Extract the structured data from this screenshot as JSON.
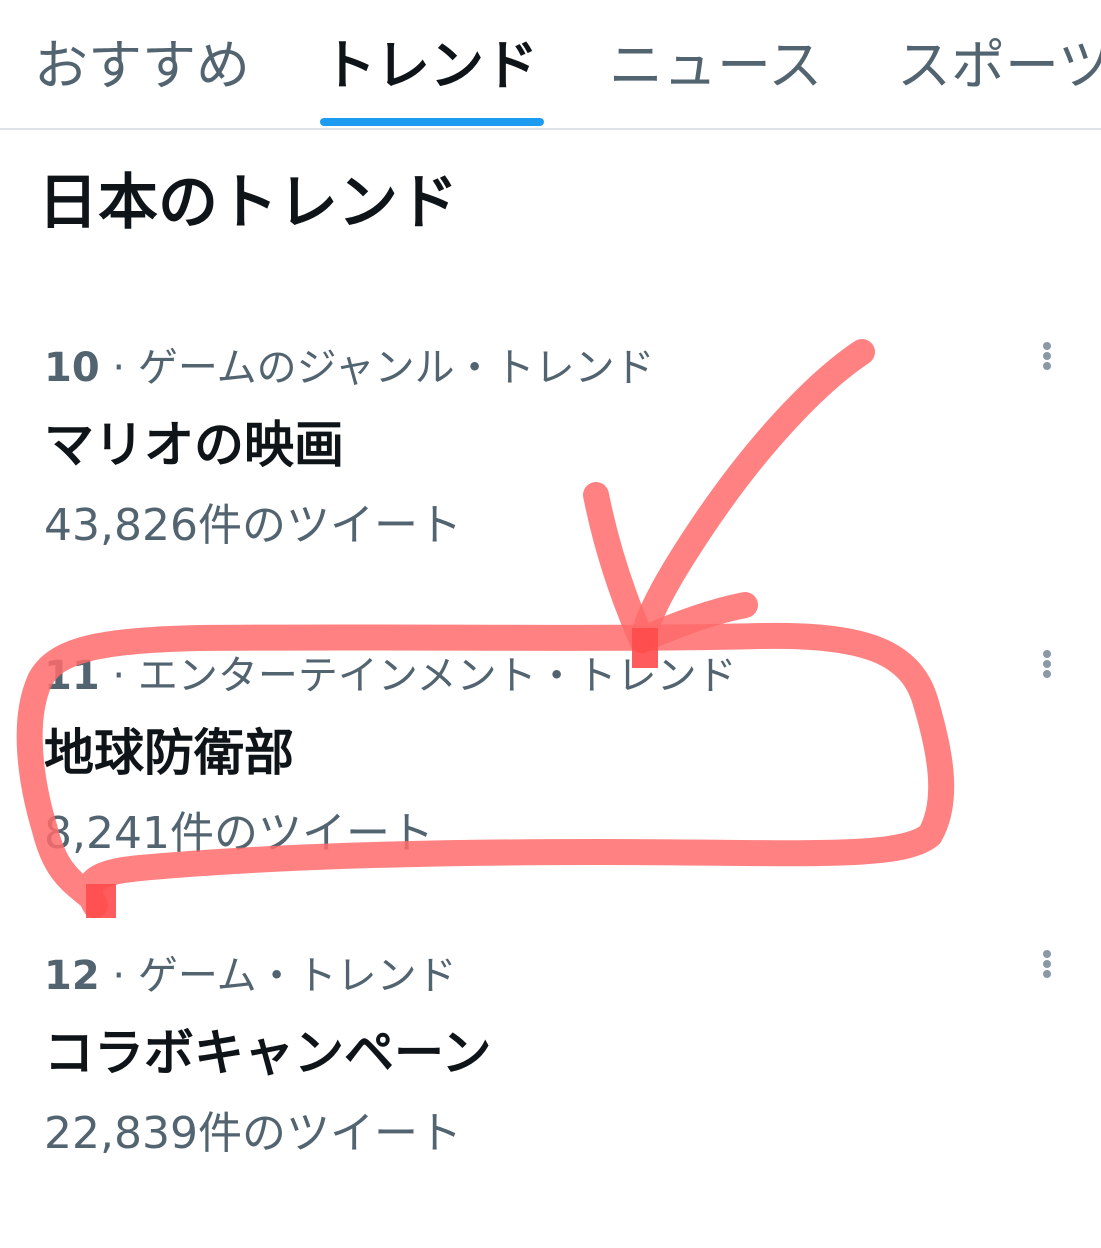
{
  "tabs": [
    {
      "label": "おすすめ",
      "active": false
    },
    {
      "label": "トレンド",
      "active": true
    },
    {
      "label": "ニュース",
      "active": false
    },
    {
      "label": "スポーツ",
      "active": false
    }
  ],
  "section_title": "日本のトレンド",
  "trends": [
    {
      "rank": "10",
      "category": "ゲームのジャンル・トレンド",
      "name": "マリオの映画",
      "count": "43,826件のツイート"
    },
    {
      "rank": "11",
      "category": "エンターテインメント・トレンド",
      "name": "地球防衛部",
      "count": "8,241件のツイート"
    },
    {
      "rank": "12",
      "category": "ゲーム・トレンド",
      "name": "コラボキャンペーン",
      "count": "22,839件のツイート"
    }
  ],
  "separator": " · ",
  "colors": {
    "accent": "#1d9bf0",
    "text_primary": "#0f1419",
    "text_secondary": "#536471",
    "annotation": "#ff6b6b"
  },
  "icons": {
    "more": "more-vertical-icon"
  }
}
